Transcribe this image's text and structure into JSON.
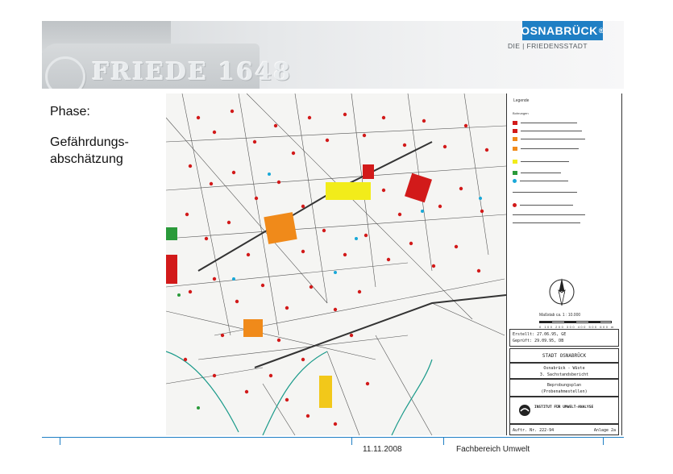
{
  "header": {
    "banner_text": "FRIEDE 1648",
    "logo": {
      "name": "OSNABRÜCK",
      "mark": "®",
      "tagline": "DIE | FRIEDENSSTADT",
      "color": "#1f7fc4"
    }
  },
  "slide": {
    "phase_label": "Phase:",
    "phase_value": "Gefährdungs-abschätzung"
  },
  "map": {
    "legend": {
      "title": "Legende",
      "heading_stations": "Bohrungen",
      "heading_measurements": "",
      "scale": "Maßstab ca. 1 : 10.000",
      "scale_ticks": "0 100 200 300 400 500 600 m",
      "drawn": "Erstellt: 27.06.95, GE",
      "checked": "Geprüft: 29.09.95, DB",
      "city": "STADT OSNABRÜCK",
      "project_line1": "Osnabrück - Wüste",
      "project_line2": "3. Sachstandsbericht",
      "plan_title_1": "Beprobungsplan",
      "plan_title_2": "(Probenahmestellen)",
      "institute": "INSTITUT FÜR UMWELT-ANALYSE",
      "order_no": "Auftr. Nr. 222-94",
      "appendix": "Anlage 2a"
    },
    "colors": {
      "red": "#d21a1a",
      "orange": "#f08a1a",
      "yellow": "#f2ec1a",
      "green": "#2a9a3a",
      "cyan": "#19a8d8",
      "teal": "#1a9a8a"
    }
  },
  "footer": {
    "date": "11.11.2008",
    "department": "Fachbereich Umwelt",
    "accent": "#1f7fc4"
  }
}
